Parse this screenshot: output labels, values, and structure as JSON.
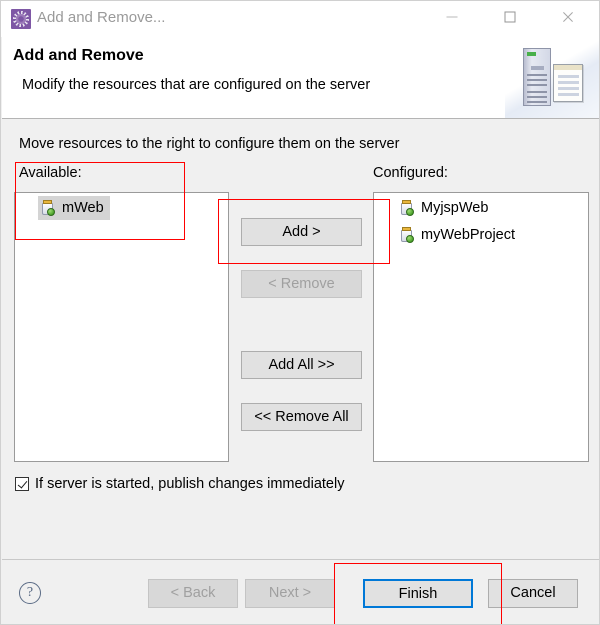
{
  "window": {
    "title": "Add and Remove...",
    "icon": "gear-icon",
    "controls": {
      "minimize": "minimize-icon",
      "maximize": "maximize-icon",
      "close": "close-icon"
    }
  },
  "header": {
    "title": "Add and Remove",
    "subtitle": "Modify the resources that are configured on the server",
    "banner_icon": "server-and-document-icon"
  },
  "main": {
    "instruction": "Move resources to the right to configure them on the server",
    "available": {
      "label": "Available:",
      "items": [
        {
          "name": "mWeb",
          "icon": "web-module-icon",
          "selected": true
        }
      ]
    },
    "configured": {
      "label": "Configured:",
      "items": [
        {
          "name": "MyjspWeb",
          "icon": "web-module-icon",
          "selected": false
        },
        {
          "name": "myWebProject",
          "icon": "web-module-icon",
          "selected": false
        }
      ]
    },
    "transfer_buttons": [
      {
        "label": "Add >",
        "enabled": true,
        "name": "add-button"
      },
      {
        "label": "< Remove",
        "enabled": false,
        "name": "remove-button"
      },
      {
        "label": "Add All >>",
        "enabled": true,
        "name": "add-all-button"
      },
      {
        "label": "<< Remove All",
        "enabled": true,
        "name": "remove-all-button"
      }
    ],
    "publish_checkbox": {
      "label": "If server is started, publish changes immediately",
      "checked": true
    }
  },
  "footer": {
    "help": "?",
    "back": "< Back",
    "next": "Next >",
    "finish": "Finish",
    "cancel": "Cancel"
  },
  "annotations": {
    "color": "#ff0000",
    "boxes": [
      {
        "target": "available-list-top"
      },
      {
        "target": "add-button"
      },
      {
        "target": "finish-button"
      }
    ]
  },
  "colors": {
    "accent": "#0078d7",
    "annotation": "#ff0000",
    "dialog_bg": "#f0f0f0",
    "header_bg": "#ffffff",
    "selection": "#d4d4d4"
  }
}
